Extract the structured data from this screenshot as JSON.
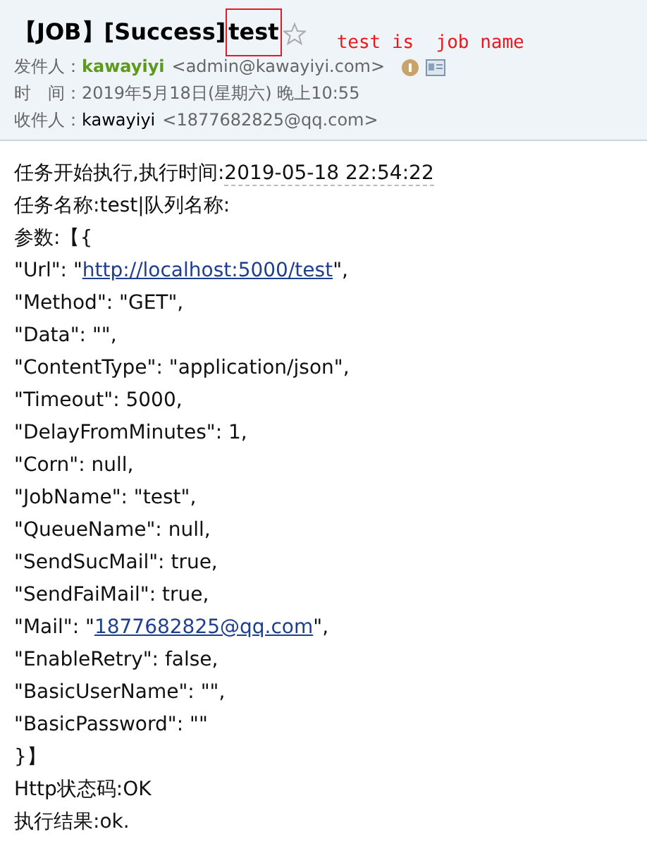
{
  "subject": {
    "prefix": "【JOB】[Success]",
    "highlight": "test",
    "starred": false
  },
  "annotation": "test is  job name",
  "sender": {
    "label": "发件人：",
    "name": "kawayiyi",
    "address": "<admin@kawayiyi.com>"
  },
  "time": {
    "label": "时　间：",
    "value": "2019年5月18日(星期六) 晚上10:55"
  },
  "recipient": {
    "label": "收件人：",
    "name": "kawayiyi",
    "address": "<1877682825@qq.com>"
  },
  "body": [
    [
      {
        "kind": "text",
        "text": "任务开始执行,执行时间:"
      },
      {
        "kind": "date",
        "text": "2019-05-18 22:54:22"
      }
    ],
    [
      {
        "kind": "text",
        "text": "任务名称:test|队列名称:"
      }
    ],
    [
      {
        "kind": "text",
        "text": "参数:【{"
      }
    ],
    [
      {
        "kind": "text",
        "text": "\"Url\": \""
      },
      {
        "kind": "link",
        "text": "http://localhost:5000/test"
      },
      {
        "kind": "text",
        "text": "\","
      }
    ],
    [
      {
        "kind": "text",
        "text": "\"Method\": \"GET\","
      }
    ],
    [
      {
        "kind": "text",
        "text": "\"Data\": \"\","
      }
    ],
    [
      {
        "kind": "text",
        "text": "\"ContentType\": \"application/json\","
      }
    ],
    [
      {
        "kind": "text",
        "text": "\"Timeout\": 5000,"
      }
    ],
    [
      {
        "kind": "text",
        "text": "\"DelayFromMinutes\": 1,"
      }
    ],
    [
      {
        "kind": "text",
        "text": "\"Corn\": null,"
      }
    ],
    [
      {
        "kind": "text",
        "text": "\"JobName\": \"test\","
      }
    ],
    [
      {
        "kind": "text",
        "text": "\"QueueName\": null,"
      }
    ],
    [
      {
        "kind": "text",
        "text": "\"SendSucMail\": true,"
      }
    ],
    [
      {
        "kind": "text",
        "text": "\"SendFaiMail\": true,"
      }
    ],
    [
      {
        "kind": "text",
        "text": "\"Mail\": \""
      },
      {
        "kind": "link",
        "text": "1877682825@qq.com"
      },
      {
        "kind": "text",
        "text": "\","
      }
    ],
    [
      {
        "kind": "text",
        "text": "\"EnableRetry\": false,"
      }
    ],
    [
      {
        "kind": "text",
        "text": "\"BasicUserName\": \"\","
      }
    ],
    [
      {
        "kind": "text",
        "text": "\"BasicPassword\": \"\""
      }
    ],
    [
      {
        "kind": "text",
        "text": "}】"
      }
    ],
    [
      {
        "kind": "text",
        "text": "Http状态码:OK"
      }
    ],
    [
      {
        "kind": "text",
        "text": "执行结果:ok."
      }
    ]
  ]
}
